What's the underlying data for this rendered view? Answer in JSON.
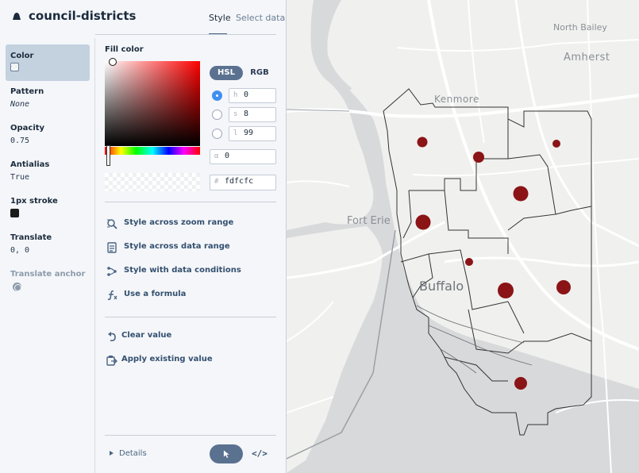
{
  "header": {
    "layer_title": "council-districts",
    "tab_style": "Style",
    "tab_select_data": "Select data"
  },
  "properties": {
    "color": {
      "label": "Color"
    },
    "pattern": {
      "label": "Pattern",
      "value": "None"
    },
    "opacity": {
      "label": "Opacity",
      "value": "0.75"
    },
    "antialias": {
      "label": "Antialias",
      "value": "True"
    },
    "stroke": {
      "label": "1px stroke"
    },
    "translate": {
      "label": "Translate",
      "value": "0, 0"
    },
    "translate_anchor": {
      "label": "Translate anchor"
    }
  },
  "picker": {
    "title": "Fill color",
    "mode_hsl": "HSL",
    "mode_rgb": "RGB",
    "h_prefix": "h",
    "h_value": "0",
    "s_prefix": "s",
    "s_value": "8",
    "l_prefix": "l",
    "l_value": "99",
    "a_prefix": "α",
    "a_value": "0",
    "hex_prefix": "#",
    "hex_value": "fdfcfc"
  },
  "actions": {
    "zoom_range": "Style across zoom range",
    "data_range": "Style across data range",
    "data_conditions": "Style with data conditions",
    "formula": "Use a formula",
    "clear": "Clear value",
    "apply_existing": "Apply existing value"
  },
  "footer": {
    "details": "Details",
    "code": "</>"
  },
  "map": {
    "labels": {
      "north_bailey": "North Bailey",
      "amherst": "Amherst",
      "kenmore": "Kenmore",
      "fort_erie": "Fort Erie",
      "buffalo": "Buffalo"
    },
    "colors": {
      "water": "#d8d9db",
      "land": "#f0f0ee",
      "road": "#ffffff",
      "boundary": "#333333",
      "marker": "#8b1416"
    }
  }
}
